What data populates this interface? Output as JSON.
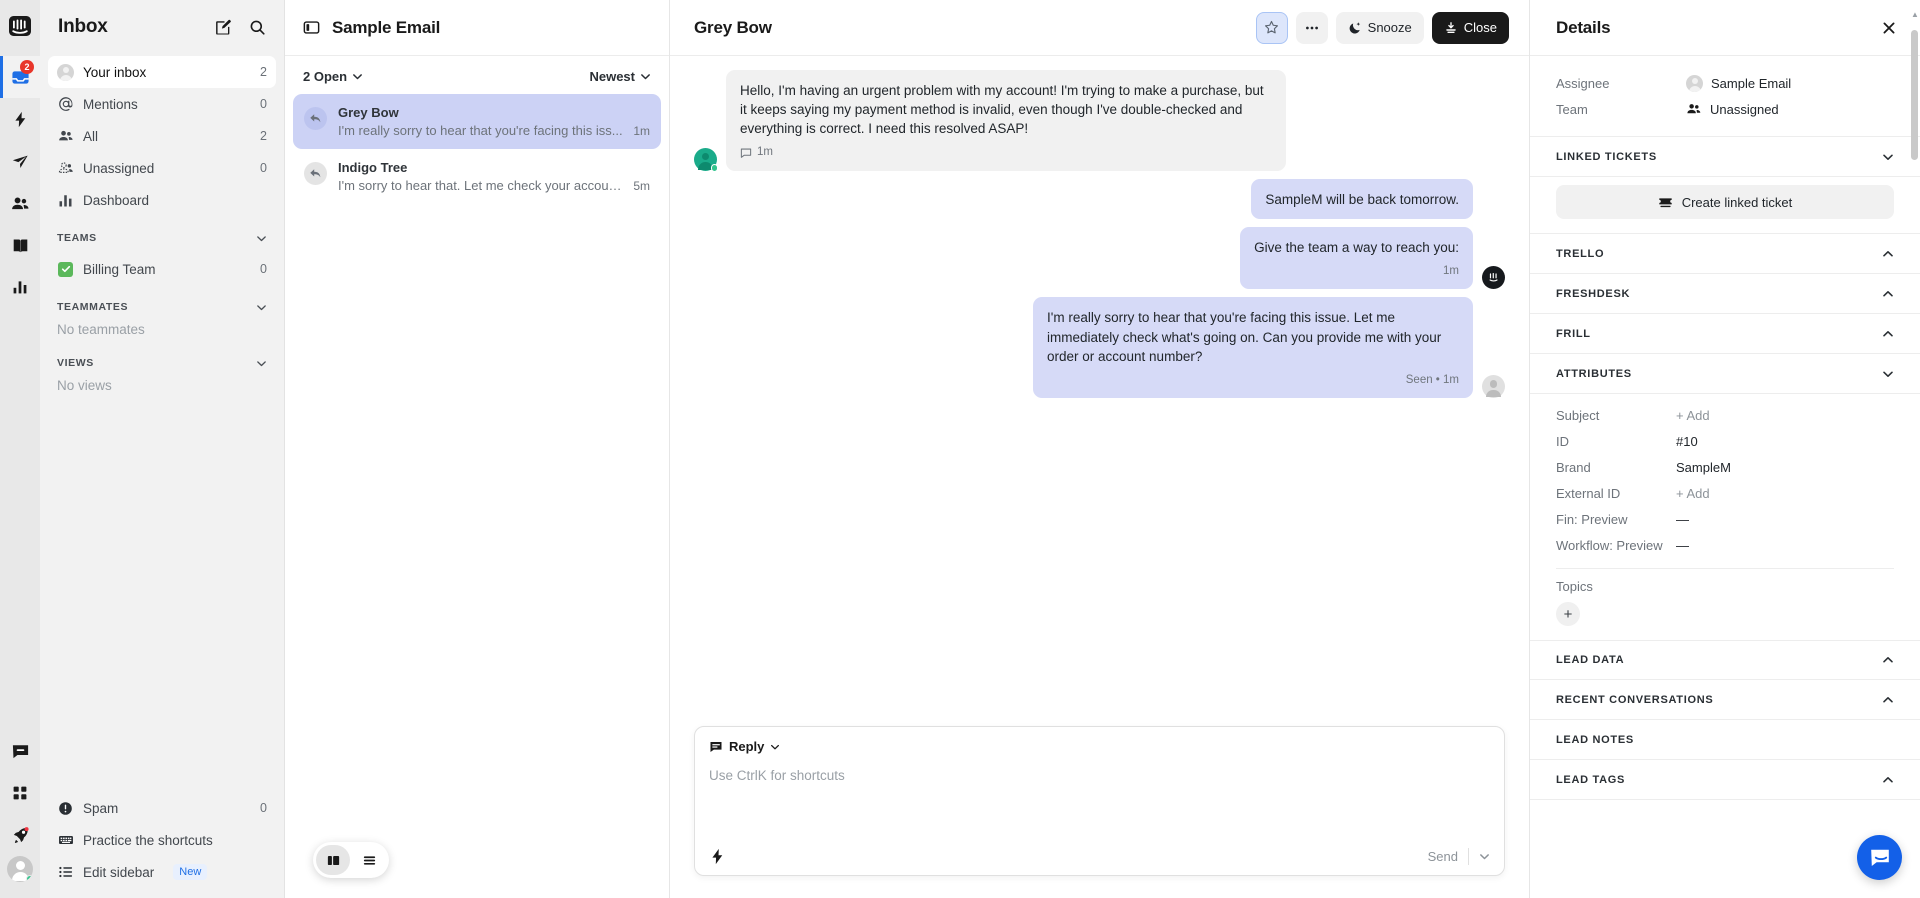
{
  "rail": {
    "logo_icon": "intercom-logo-icon",
    "items": [
      {
        "icon": "inbox-icon",
        "name": "inbox",
        "badge": "2",
        "active": true
      },
      {
        "icon": "lightning-icon",
        "name": "automation",
        "badge": "",
        "active": false
      },
      {
        "icon": "paper-plane-icon",
        "name": "outbound",
        "badge": "",
        "active": false
      },
      {
        "icon": "contacts-icon",
        "name": "contacts",
        "badge": "",
        "active": false
      },
      {
        "icon": "book-icon",
        "name": "knowledge",
        "badge": "",
        "active": false
      },
      {
        "icon": "bar-chart-icon",
        "name": "reports",
        "badge": "",
        "active": false
      },
      {
        "icon": "messenger-icon",
        "name": "messenger",
        "badge": "",
        "active": false
      },
      {
        "icon": "apps-grid-icon",
        "name": "apps",
        "badge": "",
        "active": false
      },
      {
        "icon": "rocket-icon",
        "name": "getting-started",
        "badge": "",
        "active": false
      }
    ]
  },
  "sidebar": {
    "title": "Inbox",
    "compose_icon": "compose-icon",
    "search_icon": "search-icon",
    "items": [
      {
        "label": "Your inbox",
        "count": "2",
        "icon": "avatar-icon",
        "selected": true
      },
      {
        "label": "Mentions",
        "count": "0",
        "icon": "at-icon",
        "selected": false
      },
      {
        "label": "All",
        "count": "2",
        "icon": "people-icon",
        "selected": false
      },
      {
        "label": "Unassigned",
        "count": "0",
        "icon": "unassigned-icon",
        "selected": false
      },
      {
        "label": "Dashboard",
        "count": "",
        "icon": "bar-chart-icon",
        "selected": false
      }
    ],
    "sections": [
      {
        "title": "TEAMS",
        "empty": "",
        "chevron": "chevron-down-icon",
        "items": [
          {
            "label": "Billing Team",
            "count": "0",
            "icon": "green-check-icon"
          }
        ]
      },
      {
        "title": "TEAMMATES",
        "empty": "No teammates",
        "chevron": "chevron-down-icon",
        "items": []
      },
      {
        "title": "VIEWS",
        "empty": "No views",
        "chevron": "chevron-down-icon",
        "items": []
      }
    ],
    "bottom_items": [
      {
        "label": "Spam",
        "count": "0",
        "icon": "alert-circle-icon",
        "badge": ""
      },
      {
        "label": "Practice the shortcuts",
        "count": "",
        "icon": "keyboard-icon",
        "badge": ""
      },
      {
        "label": "Edit sidebar",
        "count": "",
        "icon": "list-icon",
        "badge": "New"
      }
    ]
  },
  "conversation_list": {
    "title": "Sample Email",
    "panel_icon": "panel-toggle-icon",
    "filter_status": "2 Open",
    "sort": "Newest",
    "items": [
      {
        "name": "Grey Bow",
        "preview": "I'm really sorry to hear that you're facing this iss...",
        "time": "1m",
        "icon": "reply-arrow-icon",
        "active": true
      },
      {
        "name": "Indigo Tree",
        "preview": "I'm sorry to hear that. Let me check your accoun...",
        "time": "5m",
        "icon": "reply-arrow-icon",
        "active": false
      }
    ],
    "fab": [
      {
        "icon": "split-view-icon",
        "name": "split-view-toggle",
        "on": true
      },
      {
        "icon": "list-view-icon",
        "name": "list-view-toggle",
        "on": false
      }
    ]
  },
  "conversation": {
    "title": "Grey Bow",
    "actions": [
      {
        "label": "",
        "icon": "star-icon",
        "name": "star-button",
        "style": "starred"
      },
      {
        "label": "",
        "icon": "more-dots-icon",
        "name": "more-button",
        "style": "plain"
      },
      {
        "label": "Snooze",
        "icon": "moon-icon",
        "name": "snooze-button",
        "style": "plain"
      },
      {
        "label": "Close",
        "icon": "close-conversation-icon",
        "name": "close-button",
        "style": "dark"
      }
    ],
    "messages": [
      {
        "direction": "in",
        "text": "Hello, I'm having an urgent problem with my account! I'm trying to make a purchase, but it keeps saying my payment method is invalid, even though I've double-checked and everything is correct. I need this resolved ASAP!",
        "meta": "1m",
        "meta_icon": "comment-icon",
        "avatar": "customer-avatar"
      },
      {
        "direction": "out",
        "text": "SampleM will be back tomorrow.",
        "meta": "",
        "meta_icon": "",
        "avatar": ""
      },
      {
        "direction": "out",
        "text": "Give the team a way to reach you:",
        "meta": "1m",
        "meta_icon": "",
        "avatar": "bot-avatar"
      },
      {
        "direction": "out",
        "text": "I'm really sorry to hear that you're facing this issue. Let me immediately check what's going on. Can you provide me with your order or account number?",
        "meta": "Seen • 1m",
        "meta_icon": "",
        "avatar": "agent-avatar"
      }
    ],
    "composer": {
      "mode": "Reply",
      "mode_icon": "reply-mode-icon",
      "chevron": "chevron-down-icon",
      "placeholder": "Use CtrlK for shortcuts",
      "shortcut_icon": "lightning-icon",
      "send_label": "Send",
      "send_chevron": "chevron-down-icon"
    }
  },
  "details": {
    "title": "Details",
    "close_icon": "close-icon",
    "fields": [
      {
        "key": "Assignee",
        "value": "Sample Email",
        "icon": "avatar-icon"
      },
      {
        "key": "Team",
        "value": "Unassigned",
        "icon": "people-icon"
      }
    ],
    "linked_tickets": {
      "title": "LINKED TICKETS",
      "chevron": "chevron-down-icon",
      "button_label": "Create linked ticket",
      "button_icon": "ticket-icon"
    },
    "sections": [
      {
        "title": "TRELLO",
        "chevron": "chevron-up-icon"
      },
      {
        "title": "FRESHDESK",
        "chevron": "chevron-up-icon"
      },
      {
        "title": "FRILL",
        "chevron": "chevron-up-icon"
      }
    ],
    "attributes": {
      "title": "ATTRIBUTES",
      "chevron": "chevron-down-icon",
      "rows": [
        {
          "key": "Subject",
          "value": "+ Add",
          "muted": true
        },
        {
          "key": "ID",
          "value": "#10",
          "muted": false
        },
        {
          "key": "Brand",
          "value": "SampleM",
          "muted": false
        },
        {
          "key": "External ID",
          "value": "+ Add",
          "muted": true
        },
        {
          "key": "Fin: Preview",
          "value": "—",
          "muted": false
        },
        {
          "key": "Workflow: Preview",
          "value": "—",
          "muted": false
        }
      ],
      "topics_label": "Topics",
      "topics_add": "+"
    },
    "bottom_sections": [
      {
        "title": "LEAD DATA",
        "chevron": "chevron-up-icon"
      },
      {
        "title": "RECENT CONVERSATIONS",
        "chevron": "chevron-up-icon"
      },
      {
        "title": "LEAD NOTES",
        "chevron": ""
      },
      {
        "title": "LEAD TAGS",
        "chevron": "chevron-up-icon"
      }
    ],
    "messenger_fab_icon": "messenger-icon"
  },
  "colors": {
    "accent": "#1f6fe5",
    "badge_red": "#e8362a",
    "bubble_out": "#d6daf7",
    "bubble_in": "#f1f1f1",
    "selected_conv": "#ccd2f5",
    "green": "#5bb85b",
    "messenger_blue": "#1360e8"
  }
}
